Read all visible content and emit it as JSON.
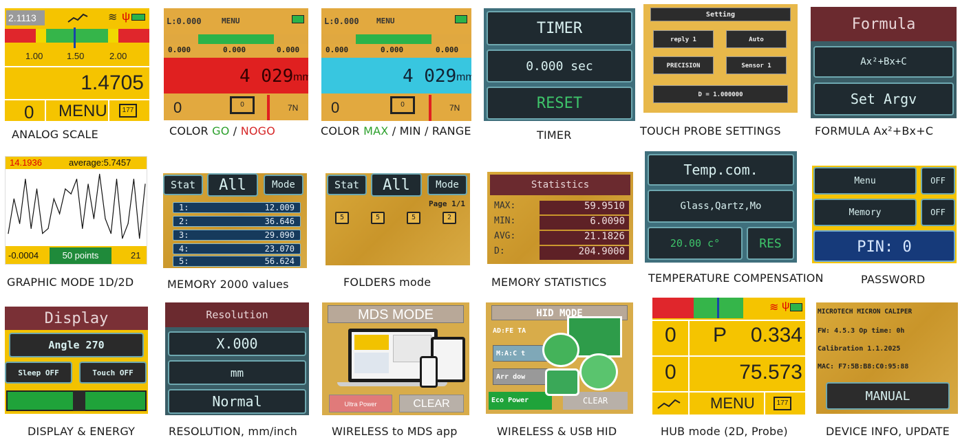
{
  "analog": {
    "top_value": "2.1113",
    "scale_labels": [
      "1.00",
      "1.50",
      "2.00"
    ],
    "reading": "1.4705",
    "left_count": "0",
    "menu_label": "MENU",
    "folder_num": "177",
    "caption": "ANALOG SCALE"
  },
  "color_go": {
    "top_left": "L:0.000",
    "menu": "MENU",
    "values": [
      "0.000",
      "0.000",
      "0.000"
    ],
    "reading": "4 029",
    "unit": "mm",
    "left_count": "0",
    "folder_num": "0",
    "right": "7N",
    "caption_a": "COLOR ",
    "caption_go": "GO",
    "caption_sep": " / ",
    "caption_nogo": "NOGO"
  },
  "color_max": {
    "top_left": "L:0.000",
    "menu": "MENU",
    "values": [
      "0.000",
      "0.000",
      "0.000"
    ],
    "reading": "4 029",
    "unit": "mm",
    "left_count": "0",
    "folder_num": "0",
    "right": "7N",
    "caption_a": "COLOR ",
    "caption_max": "MAX",
    "caption_rest": " / MIN / RANGE"
  },
  "timer": {
    "title": "TIMER",
    "value": "0.000 sec",
    "reset": "RESET",
    "caption": "TIMER"
  },
  "probe": {
    "title": "Setting",
    "reply": "reply 1",
    "auto": "Auto",
    "precision": "PRECISION",
    "sensor": "Sensor 1",
    "d_value": "D = 1.000000",
    "caption": "TOUCH PROBE SETTINGS"
  },
  "formula": {
    "title": "Formula",
    "expr": "Ax²+Bx+C",
    "set": "Set Argv",
    "caption": "FORMULA Ax²+Bx+C"
  },
  "graphic": {
    "max_val": "14.1936",
    "avg": "average:5.7457",
    "min_val": "-0.0004",
    "points": "50 points",
    "count": "21",
    "caption": "GRAPHIC MODE 1D/2D"
  },
  "memory": {
    "stat": "Stat",
    "all": "All",
    "mode": "Mode",
    "rows": [
      {
        "i": "1:",
        "v": "12.009"
      },
      {
        "i": "2:",
        "v": "36.646"
      },
      {
        "i": "3:",
        "v": "29.090"
      },
      {
        "i": "4:",
        "v": "23.070"
      },
      {
        "i": "5:",
        "v": "56.624"
      }
    ],
    "caption": "MEMORY 2000 values"
  },
  "folders": {
    "stat": "Stat",
    "all": "All",
    "mode": "Mode",
    "page": "Page 1/1",
    "items": [
      "5",
      "5",
      "5",
      "2"
    ],
    "caption": "FOLDERS mode"
  },
  "stats": {
    "title": "Statistics",
    "rows": [
      {
        "k": "MAX:",
        "v": "59.9510"
      },
      {
        "k": "MIN:",
        "v": "6.0090"
      },
      {
        "k": "AVG:",
        "v": "21.1826"
      },
      {
        "k": "D:",
        "v": "204.9000"
      }
    ],
    "caption": "MEMORY STATISTICS"
  },
  "temp": {
    "title": "Temp.com.",
    "material": "Glass,Qartz,Mo",
    "temp": "20.00 c°",
    "res": "RES",
    "caption": "TEMPERATURE COMPENSATION"
  },
  "password": {
    "menu": "Menu",
    "memory": "Memory",
    "off1": "OFF",
    "off2": "OFF",
    "pin": "PIN: 0",
    "caption": "PASSWORD"
  },
  "display": {
    "title": "Display",
    "angle": "Angle 270",
    "sleep": "Sleep OFF",
    "touch": "Touch OFF",
    "caption": "DISPLAY & ENERGY"
  },
  "resolution": {
    "title": "Resolution",
    "fmt": "X.000",
    "unit": "mm",
    "mode": "Normal",
    "caption": "RESOLUTION, mm/inch"
  },
  "mds": {
    "title": "MDS MODE",
    "ultra": "Ultra Power",
    "clear": "CLEAR",
    "caption": "WIRELESS to MDS app"
  },
  "hid": {
    "title": "HID MODE",
    "line1": "AD:FE TA",
    "btn1": "M:A:C t",
    "btn2": "Arr dow",
    "eco": "Eco Power",
    "clear": "CLEAR",
    "caption": "WIRELESS & USB HID"
  },
  "hub": {
    "r1_left": "0",
    "r1_p": "P",
    "r1_val": "0.334",
    "r2_left": "0",
    "r2_val": "75.573",
    "menu": "MENU",
    "folder_num": "177",
    "caption": "HUB mode (2D, Probe)"
  },
  "devinfo": {
    "l1": "MICROTECH MICRON CALIPER",
    "l2": "FW: 4.5.3  Op time: 0h",
    "l3": "Calibration   1.1.2025",
    "l4": "MAC: F7:5B:B8:C0:95:88",
    "manual": "MANUAL",
    "caption": "DEVICE INFO, UPDATE"
  },
  "chart_data": {
    "type": "line",
    "x": [
      1,
      2,
      3,
      4,
      5,
      6,
      7,
      8,
      9,
      10,
      11,
      12,
      13,
      14,
      15,
      16,
      17,
      18,
      19,
      20,
      21,
      22,
      23,
      24,
      25
    ],
    "values": [
      2,
      9,
      4,
      13,
      3,
      11,
      2,
      3,
      9,
      6,
      11,
      10,
      13,
      3,
      12,
      5,
      14,
      5,
      2,
      13,
      1,
      4,
      13,
      1,
      12
    ],
    "ylim": [
      -0.0004,
      14.1936
    ]
  }
}
